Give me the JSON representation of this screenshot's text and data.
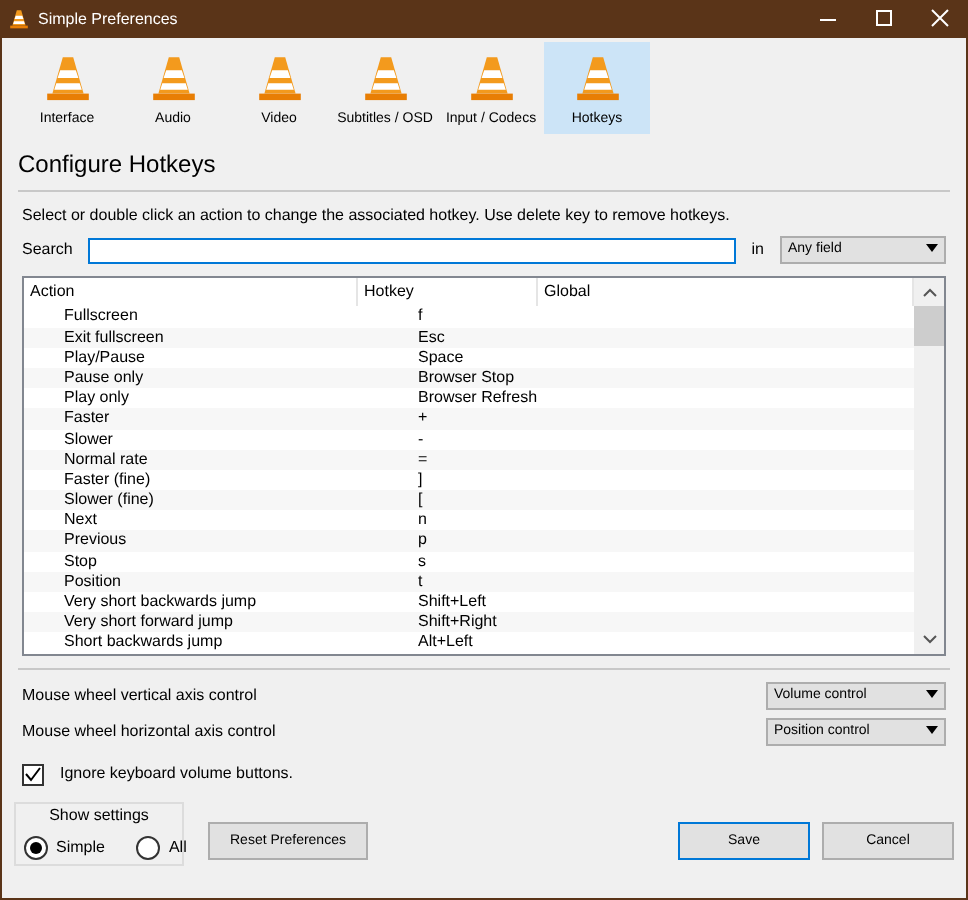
{
  "window": {
    "title": "Simple Preferences"
  },
  "tabs": [
    {
      "label": "Interface",
      "selected": false
    },
    {
      "label": "Audio",
      "selected": false
    },
    {
      "label": "Video",
      "selected": false
    },
    {
      "label": "Subtitles / OSD",
      "selected": false
    },
    {
      "label": "Input / Codecs",
      "selected": false
    },
    {
      "label": "Hotkeys",
      "selected": true
    }
  ],
  "heading": "Configure Hotkeys",
  "instructions": "Select or double click an action to change the associated hotkey. Use delete key to remove hotkeys.",
  "search": {
    "label": "Search",
    "in_label": "in",
    "scope": "Any field"
  },
  "table": {
    "columns": [
      "Action",
      "Hotkey",
      "Global"
    ],
    "rows": [
      {
        "action": "Fullscreen",
        "hotkey": "f"
      },
      {
        "action": "Exit fullscreen",
        "hotkey": "Esc"
      },
      {
        "action": "Play/Pause",
        "hotkey": "Space"
      },
      {
        "action": "Pause only",
        "hotkey": "Browser Stop"
      },
      {
        "action": "Play only",
        "hotkey": "Browser Refresh"
      },
      {
        "action": "Faster",
        "hotkey": "+"
      },
      {
        "action": "Slower",
        "hotkey": "-"
      },
      {
        "action": "Normal rate",
        "hotkey": "="
      },
      {
        "action": "Faster (fine)",
        "hotkey": "]"
      },
      {
        "action": "Slower (fine)",
        "hotkey": "["
      },
      {
        "action": "Next",
        "hotkey": "n"
      },
      {
        "action": "Previous",
        "hotkey": "p"
      },
      {
        "action": "Stop",
        "hotkey": "s"
      },
      {
        "action": "Position",
        "hotkey": "t"
      },
      {
        "action": "Very short backwards jump",
        "hotkey": "Shift+Left"
      },
      {
        "action": "Very short forward jump",
        "hotkey": "Shift+Right"
      },
      {
        "action": "Short backwards jump",
        "hotkey": "Alt+Left"
      }
    ]
  },
  "mouse_controls": [
    {
      "label": "Mouse wheel vertical axis control",
      "value": "Volume control"
    },
    {
      "label": "Mouse wheel horizontal axis control",
      "value": "Position control"
    }
  ],
  "ignore_volume": {
    "label": "Ignore keyboard volume buttons.",
    "checked": true
  },
  "show_settings": {
    "title": "Show settings",
    "options": [
      {
        "label": "Simple",
        "selected": true
      },
      {
        "label": "All",
        "selected": false
      }
    ]
  },
  "buttons": [
    {
      "label": "Reset Preferences",
      "kind": "reset"
    },
    {
      "label": "Save",
      "kind": "default"
    },
    {
      "label": "Cancel",
      "kind": "plain"
    }
  ]
}
